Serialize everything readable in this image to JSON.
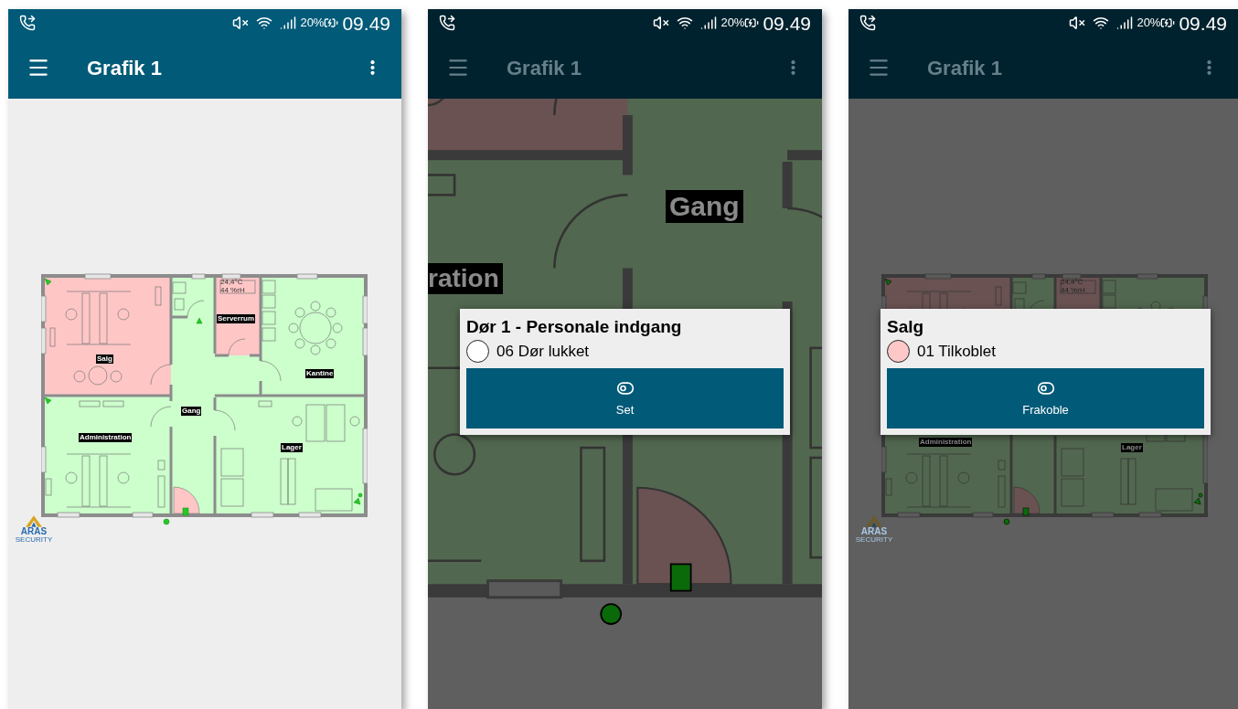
{
  "phones": [
    {
      "dimmed": false,
      "status_bar": {
        "battery": "20%",
        "time": "09.49"
      },
      "app_bar": {
        "title": "Grafik 1"
      },
      "floor_plan": {
        "kind": "full",
        "labels": [
          "Salg",
          "Serverrum",
          "Kantine",
          "Gang",
          "Administration",
          "Lager"
        ],
        "readings": [
          "24,4°C",
          "44 %rH"
        ]
      },
      "logo": {
        "name": "ARAS",
        "tagline": "SECURITY"
      }
    },
    {
      "dimmed": true,
      "status_bar": {
        "battery": "20%",
        "time": "09.49"
      },
      "app_bar": {
        "title": "Grafik 1"
      },
      "floor_plan": {
        "kind": "zoomed",
        "labels": [
          "Gang",
          "ration"
        ]
      },
      "popup": {
        "title": "Dør 1 - Personale indgang",
        "status": {
          "text": "06 Dør lukket",
          "color": "#ffffff"
        },
        "action": "Set"
      }
    },
    {
      "dimmed": true,
      "status_bar": {
        "battery": "20%",
        "time": "09.49"
      },
      "app_bar": {
        "title": "Grafik 1"
      },
      "floor_plan": {
        "kind": "full",
        "labels": [
          "Administration",
          "Lager"
        ],
        "readings": [
          "24,4°C",
          "44 %rH"
        ]
      },
      "logo": {
        "name": "ARAS",
        "tagline": "SECURITY"
      },
      "popup": {
        "title": "Salg",
        "status": {
          "text": "01 Tilkoblet",
          "color": "#ffc8c8"
        },
        "action": "Frakoble"
      }
    }
  ]
}
